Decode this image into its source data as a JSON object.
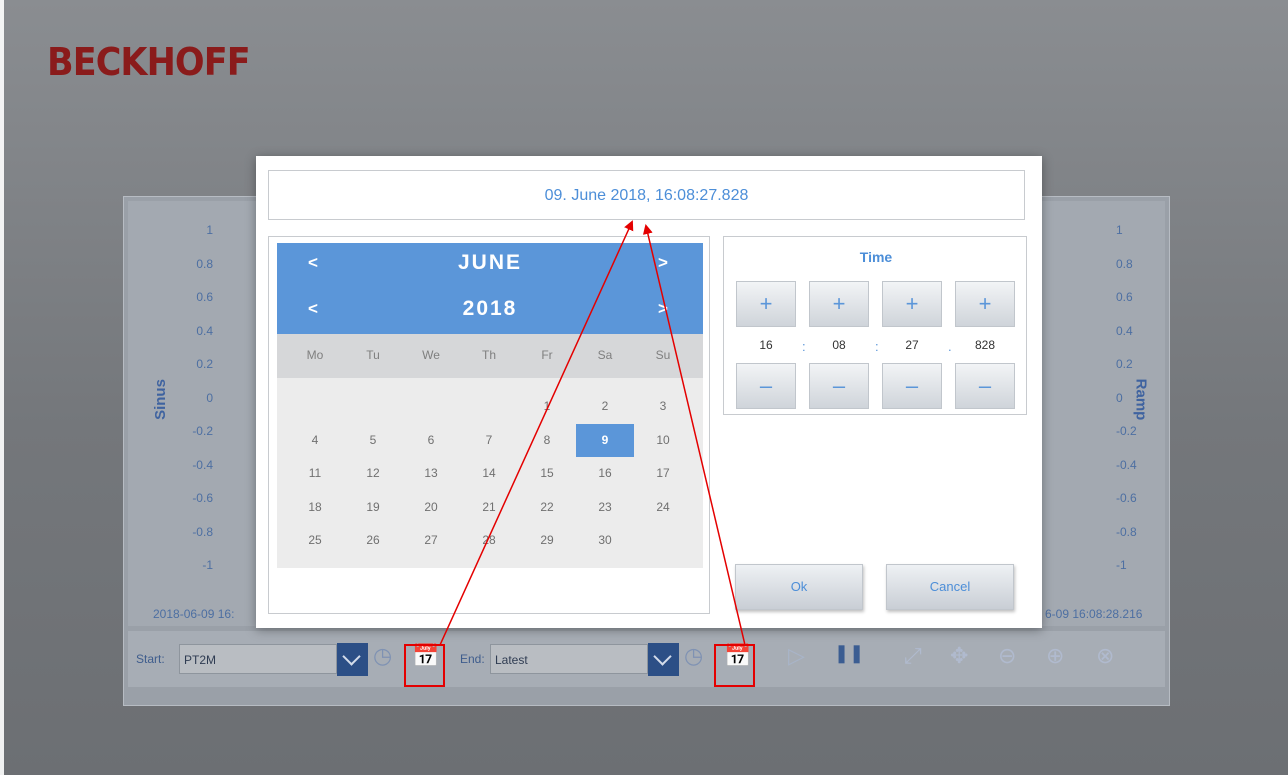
{
  "brand": {
    "logo": "BECKHOFF"
  },
  "trend": {
    "left_axis": {
      "title": "Sinus",
      "ticks": [
        "1",
        "0.8",
        "0.6",
        "0.4",
        "0.2",
        "0",
        "-0.2",
        "-0.4",
        "-0.6",
        "-0.8",
        "-1"
      ]
    },
    "right_axis": {
      "title": "Ramp",
      "ticks": [
        "1",
        "0.8",
        "0.6",
        "0.4",
        "0.2",
        "0",
        "-0.2",
        "-0.4",
        "-0.6",
        "-0.8",
        "-1"
      ]
    },
    "x_start_label": "2018-06-09 16:",
    "x_end_label": "6-09 16:08:28.216",
    "start_label": "Start:",
    "start_value": "PT2M",
    "end_label": "End:",
    "end_value": "Latest"
  },
  "dialog": {
    "display": "09. June 2018, 16:08:27.828",
    "calendar": {
      "month": "JUNE",
      "year": "2018",
      "prev_symbol": "<",
      "next_symbol": ">",
      "weekdays": [
        "Mo",
        "Tu",
        "We",
        "Th",
        "Fr",
        "Sa",
        "Su"
      ],
      "days": [
        [
          "",
          "",
          "",
          "",
          "1",
          "2",
          "3"
        ],
        [
          "4",
          "5",
          "6",
          "7",
          "8",
          "9",
          "10"
        ],
        [
          "11",
          "12",
          "13",
          "14",
          "15",
          "16",
          "17"
        ],
        [
          "18",
          "19",
          "20",
          "21",
          "22",
          "23",
          "24"
        ],
        [
          "25",
          "26",
          "27",
          "28",
          "29",
          "30",
          ""
        ]
      ],
      "selected_day": "9"
    },
    "time": {
      "title": "Time",
      "hours": "16",
      "minutes": "08",
      "seconds": "27",
      "milliseconds": "828",
      "plus": "+",
      "minus": "–",
      "sep_colon": ":",
      "sep_dot": "."
    },
    "ok_label": "Ok",
    "cancel_label": "Cancel"
  },
  "colors": {
    "accent": "#5b96d9",
    "brand": "#8a1b1b",
    "highlight": "#e40000"
  }
}
